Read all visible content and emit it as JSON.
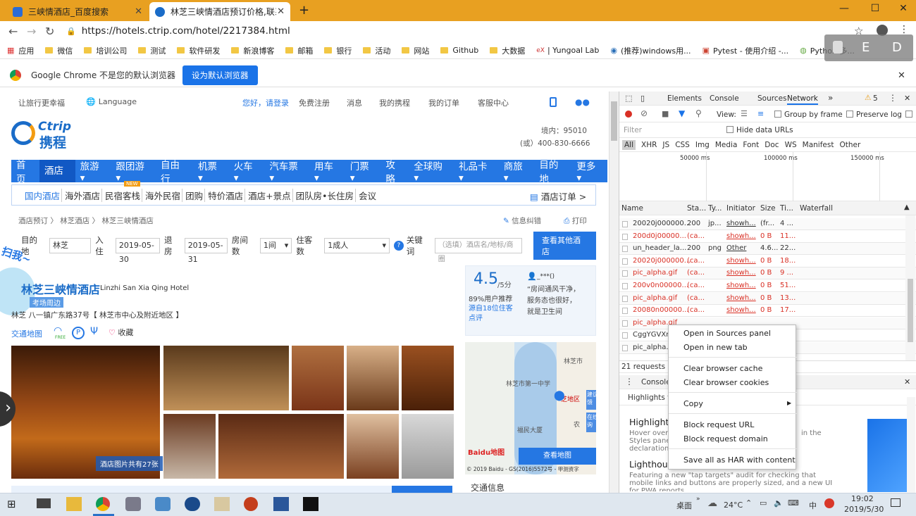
{
  "browser": {
    "tabs": [
      {
        "label": "三峡情酒店_百度搜索",
        "active": false
      },
      {
        "label": "林芝三峡情酒店预订价格,联系电话...",
        "active": true
      }
    ],
    "new_tab": "+",
    "url": "https://hotels.ctrip.com/hotel/2217384.html",
    "bookmarks": [
      "应用",
      "微信",
      "培训公司",
      "测试",
      "软件研发",
      "新浪博客",
      "邮箱",
      "银行",
      "活动",
      "网站",
      "Github",
      "大数据",
      "| Yungoal Lab",
      "(推荐)windows用...",
      "Pytest - 使用介绍 -...",
      "Python 多..."
    ],
    "infobar_text": "Google Chrome 不是您的默认浏览器",
    "infobar_button": "设为默认浏览器",
    "overlay_letters": [
      "E",
      "D"
    ]
  },
  "page": {
    "topnav": [
      "让旅行更幸福",
      "Language",
      "您好，请登录",
      "免费注册",
      "消息",
      "我的携程",
      "我的订单",
      "客服中心"
    ],
    "logo_text": "Ctrip",
    "logo_cn": "携程",
    "phone_domestic": "境内：95010",
    "phone_alt": "(或）400-830-6666",
    "mainnav": [
      "首页",
      "酒店",
      "旅游",
      "跟团游",
      "自由行",
      "机票",
      "火车",
      "汽车票",
      "用车",
      "门票",
      "攻略",
      "全球购",
      "礼品卡",
      "商旅",
      "目的地",
      "更多"
    ],
    "subnav": [
      "国内酒店",
      "海外酒店",
      "民宿客栈",
      "海外民宿",
      "团购",
      "特价酒店",
      "酒店+景点",
      "团队房•长住房",
      "会议"
    ],
    "subnav_new": "NEW",
    "hotel_order": "酒店订单 >",
    "breadcrumb": "酒店预订 〉 林芝酒店 〉 林芝三峡情酒店",
    "feedback": "信息纠错",
    "print": "打印",
    "search": {
      "dest_label": "目的地",
      "dest_value": "林芝",
      "checkin_label": "入住",
      "checkin_value": "2019-05-30",
      "checkout_label": "退房",
      "checkout_value": "2019-05-31",
      "rooms_label": "房间数",
      "rooms_value": "1间",
      "guests_label": "住客数",
      "guests_value": "1成人",
      "keyword_label": "关键词",
      "keyword_placeholder": "（选填）酒店名/地标/商圈",
      "button": "查看其他酒店"
    },
    "scan_label": "扫我~",
    "hotel_name": "林芝三峡情酒店",
    "hotel_name_en": "Linzhi San Xia Qing Hotel",
    "near_tag": "考场周边",
    "address": "林芝 八一镇广东路37号【 林芝市中心及附近地区 】",
    "traffic_map": "交通地图",
    "free_label": "FREE",
    "favorite": "收藏",
    "photo_count": "酒店图片共有27张",
    "rating": "4.5",
    "rating_max": "/5分",
    "recommend": "89%用户推荐",
    "review_source": "源自18位住客点评",
    "reviewer": "_***()",
    "review_text": "“房间通风干净，服务态也很好，就是卫生间",
    "map_labels": {
      "city": "林芝市",
      "school": "林芝市第一中学",
      "district": "芝地区",
      "road": "福民大厦",
      "bank": "农",
      "side1": "建议反馈",
      "side2": "在线咨询",
      "view_map": "查看地图",
      "copyright": "© 2019 Baidu - GS(2016)5572号 - 甲测资字",
      "baidu": "Baidu地图"
    },
    "traffic_info": "交通信息"
  },
  "devtools": {
    "tabs": [
      "Elements",
      "Console",
      "Sources",
      "Network"
    ],
    "active_tab": "Network",
    "warning_count": "5",
    "view_label": "View:",
    "group_by_frame": "Group by frame",
    "preserve_log": "Preserve log",
    "filter_placeholder": "Filter",
    "hide_data_urls": "Hide data URLs",
    "type_filters": [
      "All",
      "XHR",
      "JS",
      "CSS",
      "Img",
      "Media",
      "Font",
      "Doc",
      "WS",
      "Manifest",
      "Other"
    ],
    "timeline_ticks": [
      "50000 ms",
      "100000 ms",
      "150000 ms"
    ],
    "columns": [
      "Name",
      "Sta...",
      "Ty...",
      "Initiator",
      "Size",
      "Ti...",
      "Waterfall"
    ],
    "rows": [
      {
        "name": "20020j000000...",
        "status": "200",
        "type": "jp...",
        "initiator": "showh...",
        "size": "(fr...",
        "time": "4 ...",
        "error": false
      },
      {
        "name": "200d0j00000...",
        "status": "(ca...",
        "type": "",
        "initiator": "showh...",
        "size": "0 B",
        "time": "11...",
        "error": true
      },
      {
        "name": "un_header_la...",
        "status": "200",
        "type": "png",
        "initiator": "Other",
        "size": "4.6...",
        "time": "22...",
        "error": false
      },
      {
        "name": "20020j000000...",
        "status": "(ca...",
        "type": "",
        "initiator": "showh...",
        "size": "0 B",
        "time": "18...",
        "error": true
      },
      {
        "name": "pic_alpha.gif",
        "status": "(ca...",
        "type": "",
        "initiator": "showh...",
        "size": "0 B",
        "time": "9 ...",
        "error": true
      },
      {
        "name": "200v0n00000...",
        "status": "(ca...",
        "type": "",
        "initiator": "showh...",
        "size": "0 B",
        "time": "51...",
        "error": true
      },
      {
        "name": "pic_alpha.gif",
        "status": "(ca...",
        "type": "",
        "initiator": "showh...",
        "size": "0 B",
        "time": "13...",
        "error": true
      },
      {
        "name": "20080n00000...",
        "status": "(ca...",
        "type": "",
        "initiator": "showh...",
        "size": "0 B",
        "time": "17...",
        "error": true
      },
      {
        "name": "pic_alpha.gif",
        "status": "",
        "type": "",
        "initiator": "",
        "size": "",
        "time": "",
        "error": true
      },
      {
        "name": "CggYGVXrX",
        "status": "",
        "type": "",
        "initiator": "",
        "size": "",
        "time": "",
        "error": false
      },
      {
        "name": "pic_alpha.gif",
        "status": "",
        "type": "",
        "initiator": "",
        "size": "",
        "time": "",
        "error": false
      }
    ],
    "summary": "21 requests",
    "drawer_tab": "Console",
    "highlights_tab": "Highlights fro",
    "highlight_title": "Highlight a",
    "highlight_text": "Hover over Styles pane declaration",
    "highlight_text_right": "in the",
    "lighthouse_title": "Lighthouse",
    "lighthouse_text": "Featuring a new \"tap targets\" audit for checking that mobile links and buttons are properly sized, and a new UI for PWA reports"
  },
  "context_menu": {
    "items": [
      "Open in Sources panel",
      "Open in new tab",
      "Clear browser cache",
      "Clear browser cookies",
      "Copy",
      "Block request URL",
      "Block request domain",
      "Save all as HAR with content"
    ]
  },
  "taskbar": {
    "desktop_label": "桌面",
    "temperature": "24°C",
    "ime": "中",
    "time": "19:02",
    "date": "2019/5/30"
  }
}
